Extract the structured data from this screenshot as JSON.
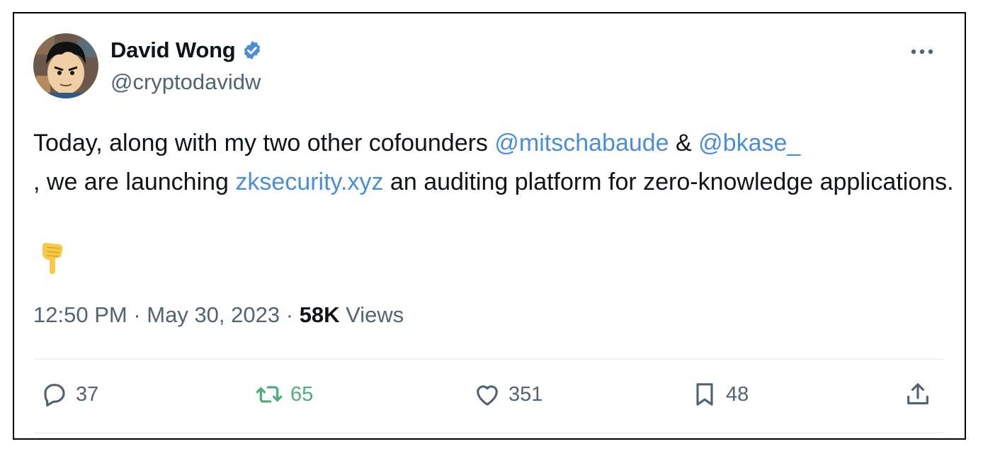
{
  "author": {
    "display_name": "David Wong",
    "handle": "@cryptodavidw",
    "verified_icon": "verified-badge-icon"
  },
  "tweet": {
    "text_1": "Today, along with my two other cofounders ",
    "mention_1": "@mitschabaude",
    "text_2": "  & ",
    "mention_2": "@bkase_",
    "text_3": " , we are launching  ",
    "link": "zksecurity.xyz",
    "text_4": " an auditing platform for zero-knowledge applications.",
    "emoji": "backhand-index-pointing-down"
  },
  "meta": {
    "time": "12:50 PM",
    "sep1": " · ",
    "date": "May 30, 2023",
    "sep2": " · ",
    "views_count": "58K",
    "views_label": " Views"
  },
  "actions": {
    "reply_count": "37",
    "retweet_count": "65",
    "like_count": "351",
    "bookmark_count": "48"
  },
  "colors": {
    "link": "#4a8ed8",
    "secondary_text": "#536471",
    "retweet_active": "#4caf7a",
    "verified": "#4a8ed8"
  }
}
